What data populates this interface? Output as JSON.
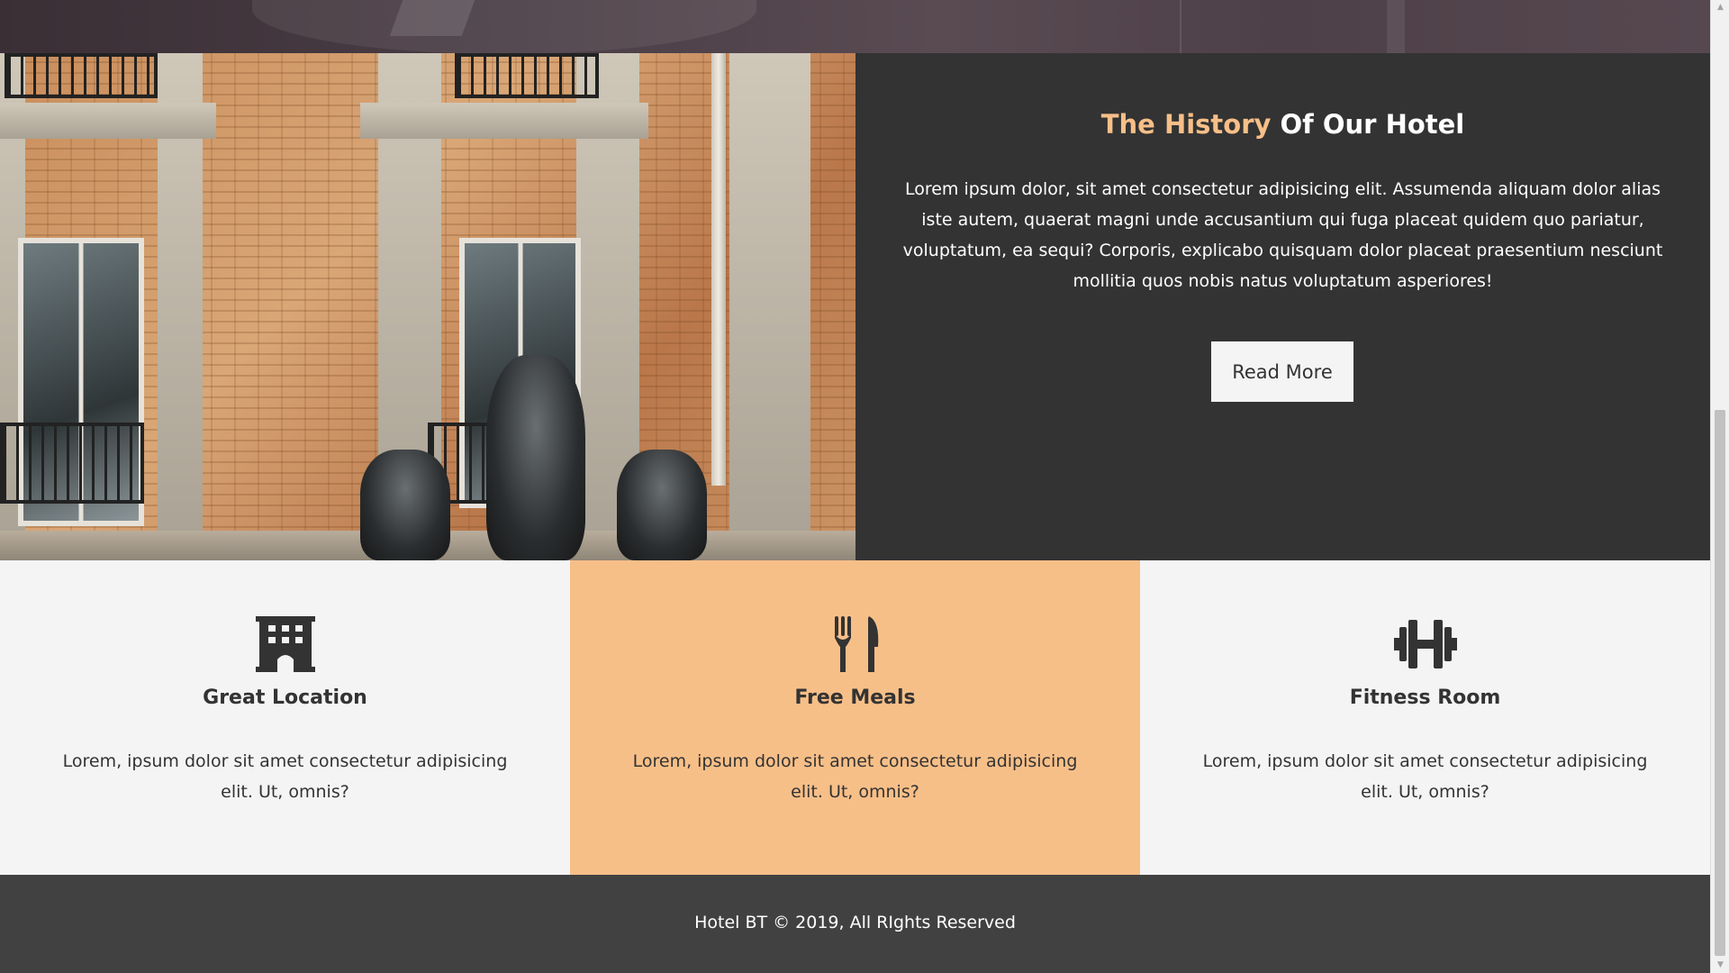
{
  "history": {
    "title_accent": "The History",
    "title_rest": " Of Our Hotel",
    "body": "Lorem ipsum dolor, sit amet consectetur adipisicing elit. Assumenda aliquam dolor alias iste autem, quaerat magni unde accusantium qui fuga placeat quidem quo pariatur, voluptatum, ea sequi? Corporis, explicabo quisquam dolor placeat praesentium nesciunt mollitia quos nobis natus voluptatum asperiores!",
    "button_label": "Read More",
    "image_alt": "hotel-building-facade"
  },
  "features": [
    {
      "icon": "building-icon",
      "title": "Great Location",
      "text": "Lorem, ipsum dolor sit amet consectetur adipisicing elit. Ut, omnis?"
    },
    {
      "icon": "utensils-icon",
      "title": "Free Meals",
      "text": "Lorem, ipsum dolor sit amet consectetur adipisicing elit. Ut, omnis?"
    },
    {
      "icon": "dumbbell-icon",
      "title": "Fitness Room",
      "text": "Lorem, ipsum dolor sit amet consectetur adipisicing elit. Ut, omnis?"
    }
  ],
  "footer": {
    "text": "Hotel BT © 2019, All RIghts Reserved"
  },
  "colors": {
    "accent": "#f7bf88",
    "dark": "#333333",
    "light": "#f4f4f4",
    "footer": "#414141"
  }
}
